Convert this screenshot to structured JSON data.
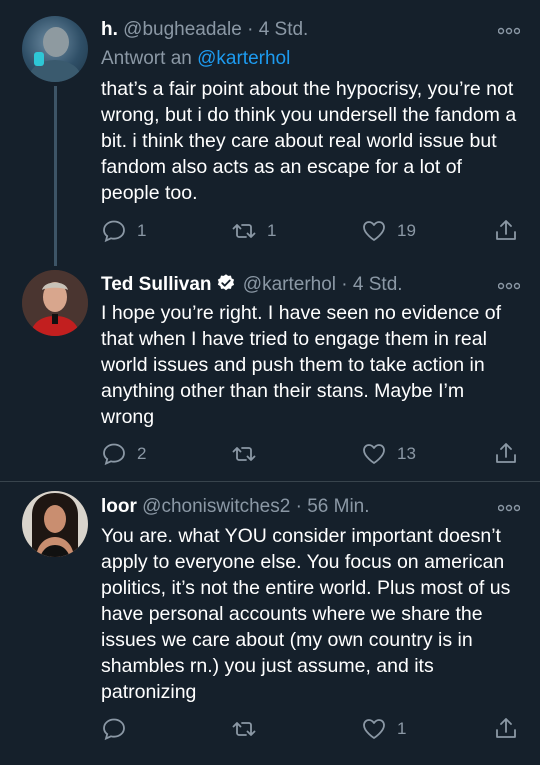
{
  "tweets": [
    {
      "name": "h.",
      "handle": "@bugheadale",
      "time": "4 Std.",
      "reply_prefix": "Antwort an",
      "reply_handle": "@karterhol",
      "text": "that’s a fair point about the hypocrisy, you’re not wrong, but i do think you undersell the fandom a bit. i think they care about real world issue but fandom also acts as an escape for a lot of people too.",
      "replies": "1",
      "retweets": "1",
      "likes": "19"
    },
    {
      "name": "Ted Sullivan",
      "handle": "@karterhol",
      "time": "4 Std.",
      "verified": true,
      "text": "I hope you’re right. I have seen no evidence of that when I have tried to engage them in real world issues and push them to take action in anything other than their stans. Maybe I’m wrong",
      "replies": "2",
      "retweets": "",
      "likes": "13"
    },
    {
      "name": "loor",
      "handle": "@choniswitches2",
      "time": "56 Min.",
      "text": "You are. what YOU consider important doesn’t apply to everyone else. You focus on american politics, it’s not the entire world. Plus most of us have personal accounts where we share the issues we care about (my own country is in shambles rn.) you just assume, and its patronizing",
      "replies": "",
      "retweets": "",
      "likes": "1"
    }
  ],
  "dot_sep": "·",
  "colors": {
    "background": "#15202b",
    "muted": "#8b98a5",
    "link": "#1d9bf0",
    "verified": "#ffffff"
  }
}
